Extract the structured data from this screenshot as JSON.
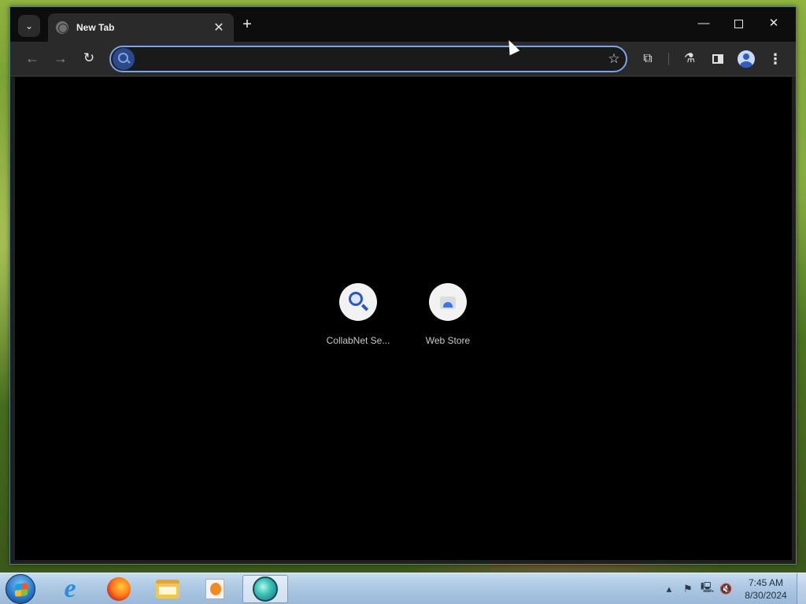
{
  "browser": {
    "tab": {
      "title": "New Tab",
      "close_glyph": "✕"
    },
    "tab_search_glyph": "⌄",
    "new_tab_glyph": "+",
    "window_controls": {
      "minimize_glyph": "—",
      "close_glyph": "✕"
    },
    "toolbar": {
      "back_glyph": "←",
      "forward_glyph": "→",
      "reload_glyph": "↻",
      "omnibox_value": "",
      "star_glyph": "☆",
      "extensions_glyph": "⧉",
      "labs_glyph": "⚗",
      "menu_glyph": "⋮"
    },
    "shortcuts": [
      {
        "label": "CollabNet Se...",
        "icon": "search-icon"
      },
      {
        "label": "Web Store",
        "icon": "web-store-icon"
      }
    ],
    "accent_color": "#7ba4e8"
  },
  "taskbar": {
    "apps": [
      "internet-explorer-icon",
      "firefox-icon",
      "file-explorer-icon",
      "media-player-icon",
      "app-icon"
    ],
    "ie_glyph": "e",
    "tray": {
      "arrow_glyph": "▴",
      "flag_glyph": "⚑",
      "network_glyph": "🖳",
      "volume_glyph": "🔇"
    },
    "clock": {
      "time": "7:45 AM",
      "date": "8/30/2024"
    }
  }
}
